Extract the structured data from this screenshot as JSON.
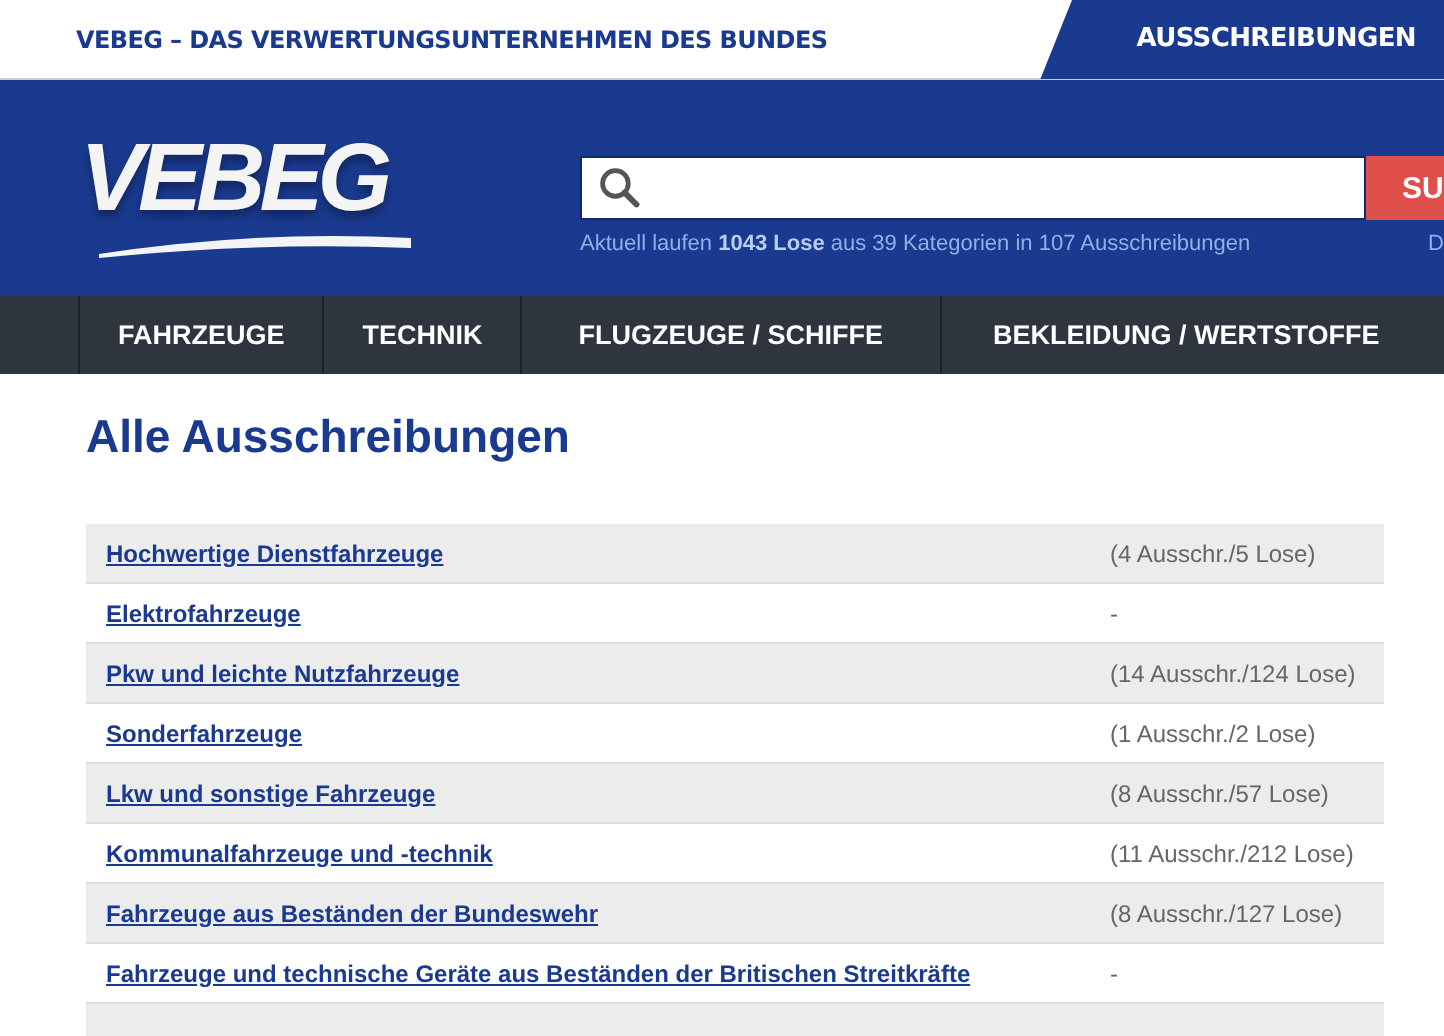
{
  "top_bar": {
    "tagline": "VEBEG – DAS VERWERTUNGSUNTERNEHMEN DES BUNDES",
    "tab": "AUSSCHREIBUNGEN"
  },
  "header": {
    "logo": "VEBEG",
    "search": {
      "button": "SU"
    },
    "info": "Aktuell laufen **1043 Lose** aus 39 Kategorien in 107 Ausschreibungen",
    "info_right": "D"
  },
  "nav": [
    "FAHRZEUGE",
    "TECHNIK",
    "FLUGZEUGE / SCHIFFE",
    "BEKLEIDUNG / WERTSTOFFE"
  ],
  "heading": "Alle Ausschreibungen",
  "table": {
    "rows": [
      {
        "name": "Hochwertige Dienstfahrzeuge",
        "count": "(4 Ausschr./5 Lose)"
      },
      {
        "name": "Elektrofahrzeuge",
        "count": "-"
      },
      {
        "name": "Pkw und leichte Nutzfahrzeuge",
        "count": "(14 Ausschr./124 Lose)"
      },
      {
        "name": "Sonderfahrzeuge",
        "count": "(1 Ausschr./2 Lose)"
      },
      {
        "name": "Lkw und sonstige Fahrzeuge",
        "count": "(8 Ausschr./57 Lose)"
      },
      {
        "name": "Kommunalfahrzeuge und -technik",
        "count": "(11 Ausschr./212 Lose)"
      },
      {
        "name": "Fahrzeuge aus Beständen der Bundeswehr",
        "count": "(8 Ausschr./127 Lose)"
      },
      {
        "name": "Fahrzeuge und technische Geräte aus Beständen der Britischen Streitkräfte",
        "count": "-"
      }
    ]
  }
}
